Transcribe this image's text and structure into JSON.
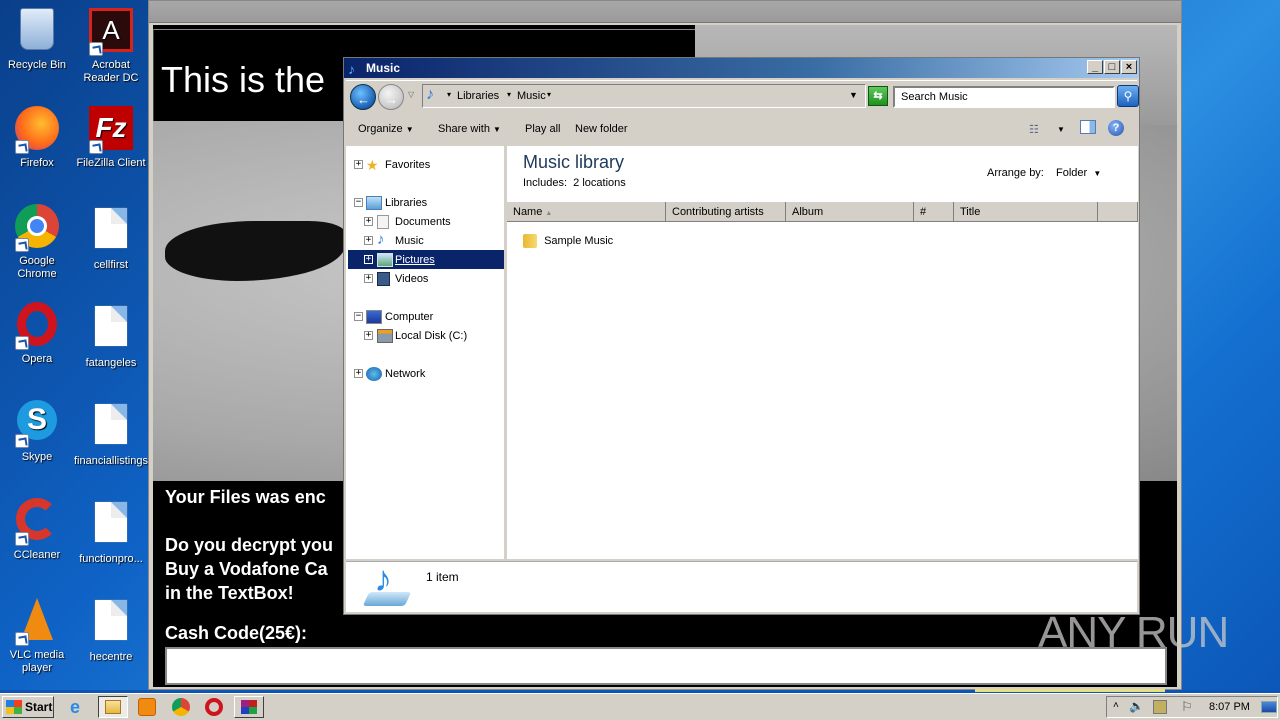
{
  "desktop": {
    "icons": [
      {
        "label": "Recycle Bin",
        "icon": "recycle-bin-icon"
      },
      {
        "label": "Acrobat Reader DC",
        "icon": "acrobat-icon"
      },
      {
        "label": "Firefox",
        "icon": "firefox-icon"
      },
      {
        "label": "FileZilla Client",
        "icon": "filezilla-icon"
      },
      {
        "label": "Google Chrome",
        "icon": "chrome-icon"
      },
      {
        "label": "cellfirst",
        "icon": "document-icon"
      },
      {
        "label": "Opera",
        "icon": "opera-icon"
      },
      {
        "label": "fatangeles",
        "icon": "document-icon"
      },
      {
        "label": "Skype",
        "icon": "skype-icon"
      },
      {
        "label": "financiallistings",
        "icon": "document-icon"
      },
      {
        "label": "CCleaner",
        "icon": "ccleaner-icon"
      },
      {
        "label": "functionpro...",
        "icon": "document-icon"
      },
      {
        "label": "VLC media player",
        "icon": "vlc-icon"
      },
      {
        "label": "hecentre",
        "icon": "document-icon"
      }
    ]
  },
  "ransom": {
    "title": "This is the",
    "line1": "Your Files was enc",
    "line2": "Do you decrypt you",
    "line3": "Buy a Vodafone Ca",
    "line4": "in the TextBox!",
    "cash_label": "Cash Code(25€):",
    "cash_value": ""
  },
  "explorer": {
    "title": "Music",
    "breadcrumb": [
      "Libraries",
      "Music"
    ],
    "search_placeholder": "Search Music",
    "toolbar": {
      "organize": "Organize",
      "share_with": "Share with",
      "play_all": "Play all",
      "new_folder": "New folder"
    },
    "nav": {
      "favorites": "Favorites",
      "libraries": "Libraries",
      "documents": "Documents",
      "music": "Music",
      "pictures": "Pictures",
      "videos": "Videos",
      "computer": "Computer",
      "local_disk": "Local Disk (C:)",
      "network": "Network"
    },
    "library_title": "Music library",
    "includes_label": "Includes:",
    "includes_value": "2 locations",
    "arrange_label": "Arrange by:",
    "arrange_value": "Folder",
    "columns": [
      "Name",
      "Contributing artists",
      "Album",
      "#",
      "Title"
    ],
    "items": [
      {
        "name": "Sample Music",
        "type": "folder"
      }
    ],
    "status": "1 item"
  },
  "taskbar": {
    "start": "Start",
    "clock": "8:07 PM"
  },
  "watermark": "ANY RUN"
}
